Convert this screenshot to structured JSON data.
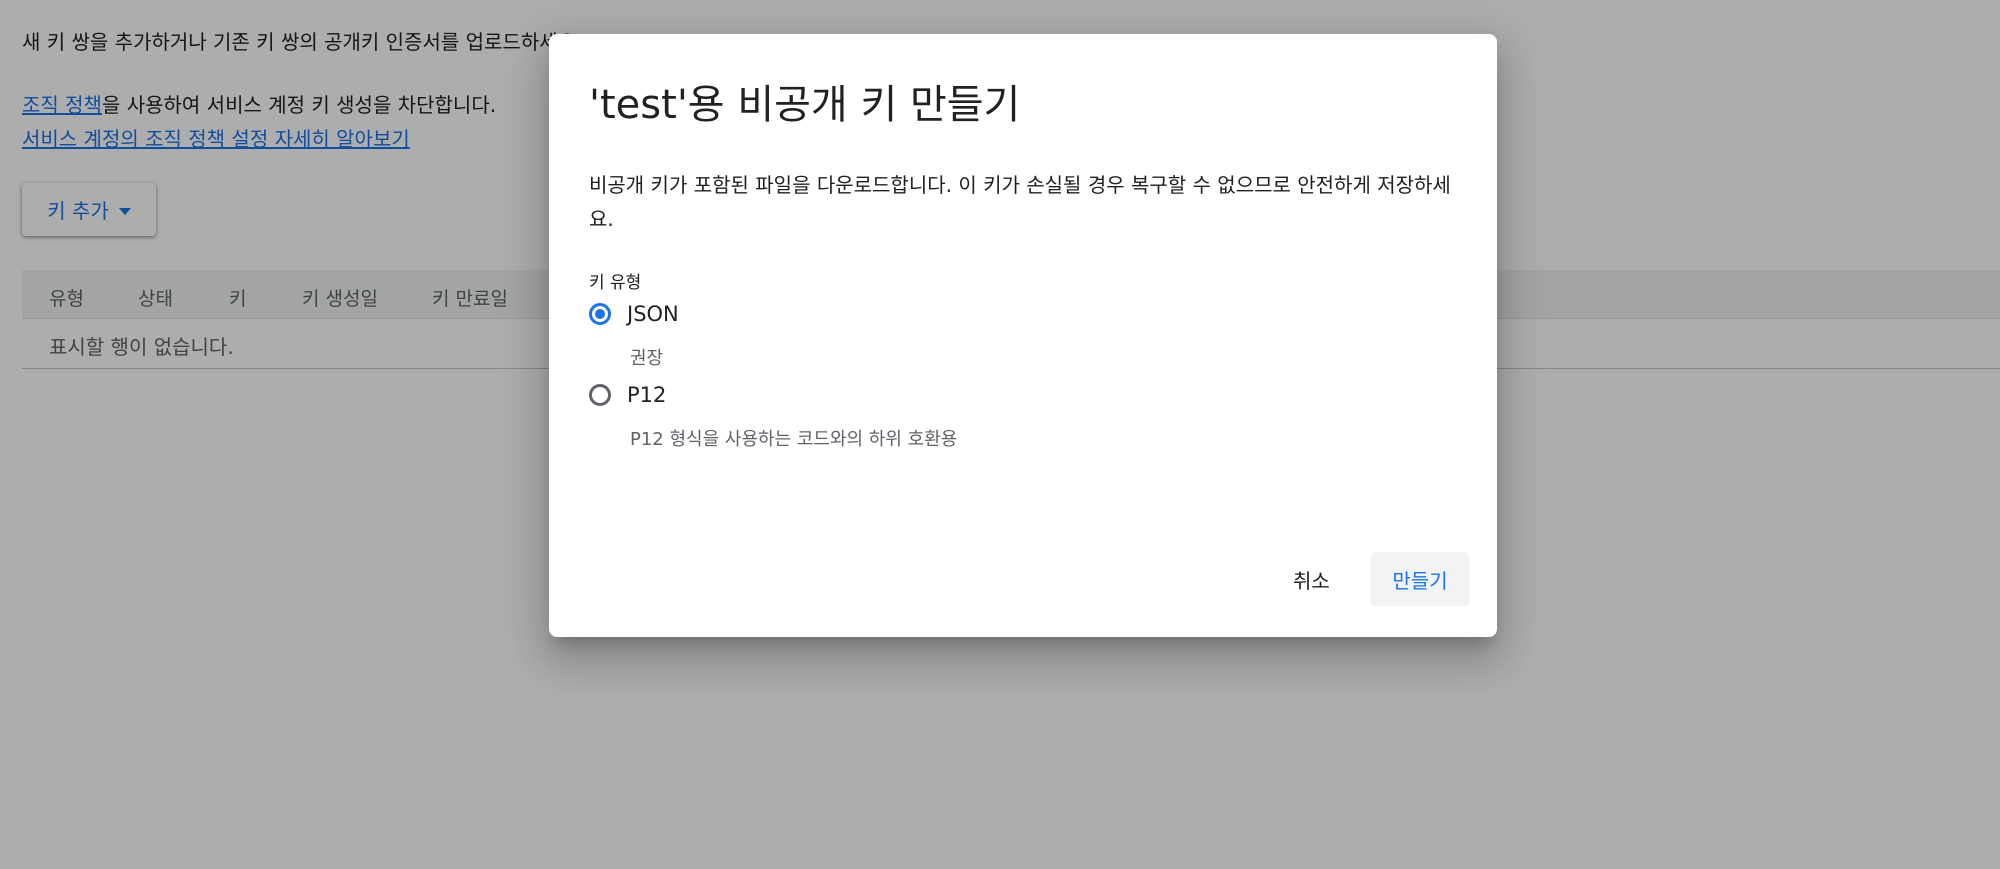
{
  "background": {
    "intro_text": "새 키 쌍을 추가하거나 기존 키 쌍의 공개키 인증서를 업로드하세요.",
    "policy_link": "조직 정책",
    "policy_text": "을 사용하여 서비스 계정 키 생성을 차단합니다.",
    "learn_more_link": "서비스 계정의 조직 정책 설정 자세히 알아보기",
    "add_key_label": "키 추가",
    "table": {
      "columns": [
        "유형",
        "상태",
        "키",
        "키 생성일",
        "키 만료일"
      ],
      "empty_text": "표시할 행이 없습니다."
    }
  },
  "dialog": {
    "title": "'test'용 비공개 키 만들기",
    "description": "비공개 키가 포함된 파일을 다운로드합니다. 이 키가 손실될 경우 복구할 수 없으므로 안전하게 저장하세요.",
    "key_type_label": "키 유형",
    "options": [
      {
        "label": "JSON",
        "sub": "권장",
        "selected": true
      },
      {
        "label": "P12",
        "sub": "P12 형식을 사용하는 코드와의 하위 호환용",
        "selected": false
      }
    ],
    "cancel_label": "취소",
    "create_label": "만들기"
  },
  "colors": {
    "accent": "#1a73e8",
    "scrim": "rgba(0,0,0,0.32)"
  }
}
